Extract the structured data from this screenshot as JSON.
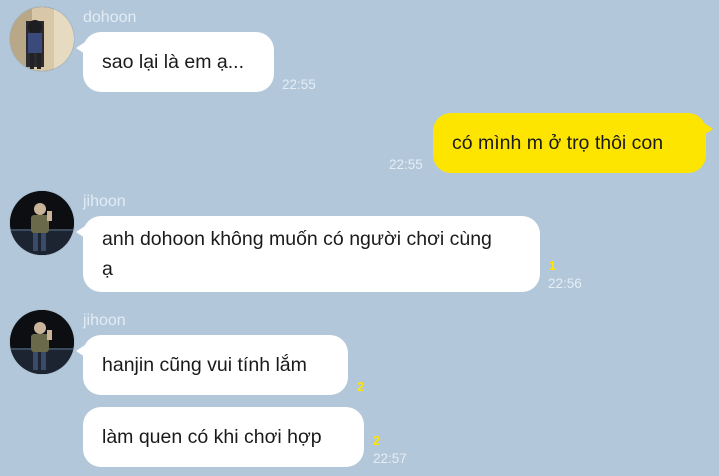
{
  "colors": {
    "background": "#b2c7da",
    "my_bubble": "#fee500",
    "their_bubble": "#ffffff",
    "unread": "#fee500"
  },
  "messages": {
    "g1": {
      "sender": "dohoon",
      "text": "sao lại là em ạ...",
      "time": "22:55"
    },
    "g2": {
      "text": "có mình m ở trọ thôi con",
      "time": "22:55"
    },
    "g3": {
      "sender": "jihoon",
      "text": "anh dohoon không muốn có người chơi cùng ạ",
      "unread": "1",
      "time": "22:56"
    },
    "g4": {
      "sender": "jihoon",
      "m1": {
        "text": "hanjin cũng vui tính lắm",
        "unread": "2"
      },
      "m2": {
        "text": "làm quen có khi chơi hợp",
        "unread": "2",
        "time": "22:57"
      }
    }
  }
}
